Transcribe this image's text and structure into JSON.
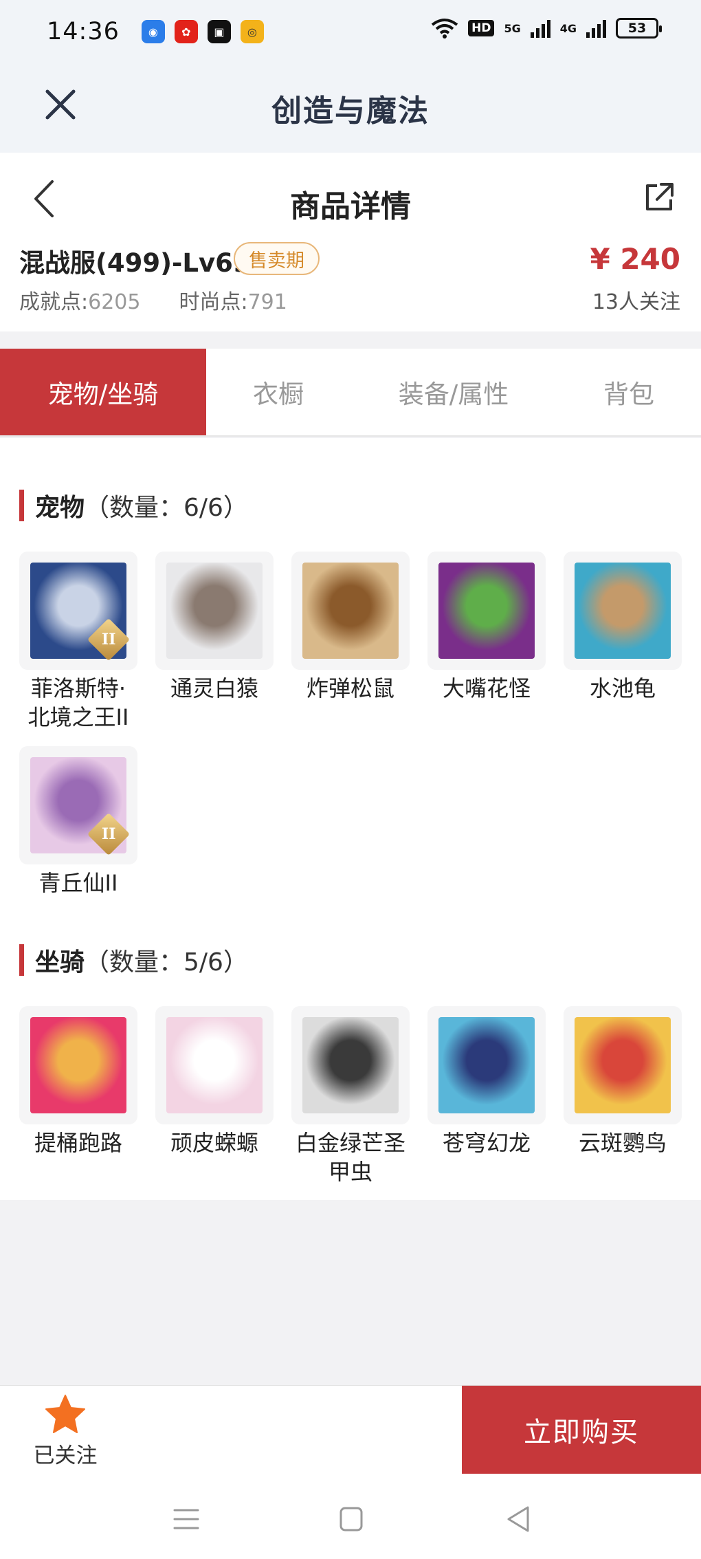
{
  "status": {
    "time": "14:36",
    "hd": "HD",
    "net1": "5G",
    "net2": "4G",
    "battery": "53"
  },
  "app_bar": {
    "title": "创造与魔法"
  },
  "detail": {
    "page_title": "商品详情",
    "product_name": "混战服(499)-Lv69",
    "sale_badge": "售卖期",
    "price": "¥ 240",
    "achievement_label": "成就点:",
    "achievement_value": "6205",
    "fashion_label": "时尚点:",
    "fashion_value": "791",
    "followers": "13人关注"
  },
  "tabs": [
    {
      "label": "宠物/坐骑",
      "active": true
    },
    {
      "label": "衣橱",
      "active": false
    },
    {
      "label": "装备/属性",
      "active": false
    },
    {
      "label": "背包",
      "active": false
    }
  ],
  "pets": {
    "title": "宠物",
    "count": "（数量：6/6）",
    "items": [
      {
        "label": "菲洛斯特·\n北境之王II",
        "grade": "II",
        "colors": [
          "#2c4a8a",
          "#c9d3e6"
        ]
      },
      {
        "label": "通灵白猿",
        "colors": [
          "#e8e8ea",
          "#8a7a70"
        ]
      },
      {
        "label": "炸弹松鼠",
        "colors": [
          "#d9b98a",
          "#8b5a2b"
        ]
      },
      {
        "label": "大嘴花怪",
        "colors": [
          "#7a2e8a",
          "#5fae4a"
        ]
      },
      {
        "label": "水池龟",
        "colors": [
          "#3fa9c9",
          "#c49a6a"
        ]
      },
      {
        "label": "青丘仙II",
        "grade": "II",
        "colors": [
          "#e7c9e6",
          "#9a6bb5"
        ]
      }
    ]
  },
  "mounts": {
    "title": "坐骑",
    "count": "（数量：5/6）",
    "items": [
      {
        "label": "提桶跑路",
        "colors": [
          "#e83a6a",
          "#f0b24a"
        ]
      },
      {
        "label": "顽皮蝾螈",
        "colors": [
          "#f3d4e3",
          "#ffffff"
        ]
      },
      {
        "label": "白金绿芒圣\n甲虫",
        "colors": [
          "#dcdcdc",
          "#3a3a3a"
        ]
      },
      {
        "label": "苍穹幻龙",
        "colors": [
          "#59b6d9",
          "#2b3a7a"
        ]
      },
      {
        "label": "云斑鹦鸟",
        "colors": [
          "#f1c24b",
          "#d9463a"
        ]
      }
    ]
  },
  "bottom": {
    "follow_label": "已关注",
    "buy_label": "立即购买"
  },
  "colors": {
    "accent": "#c6373a",
    "star": "#f37021",
    "badge": "#d58a2a"
  }
}
